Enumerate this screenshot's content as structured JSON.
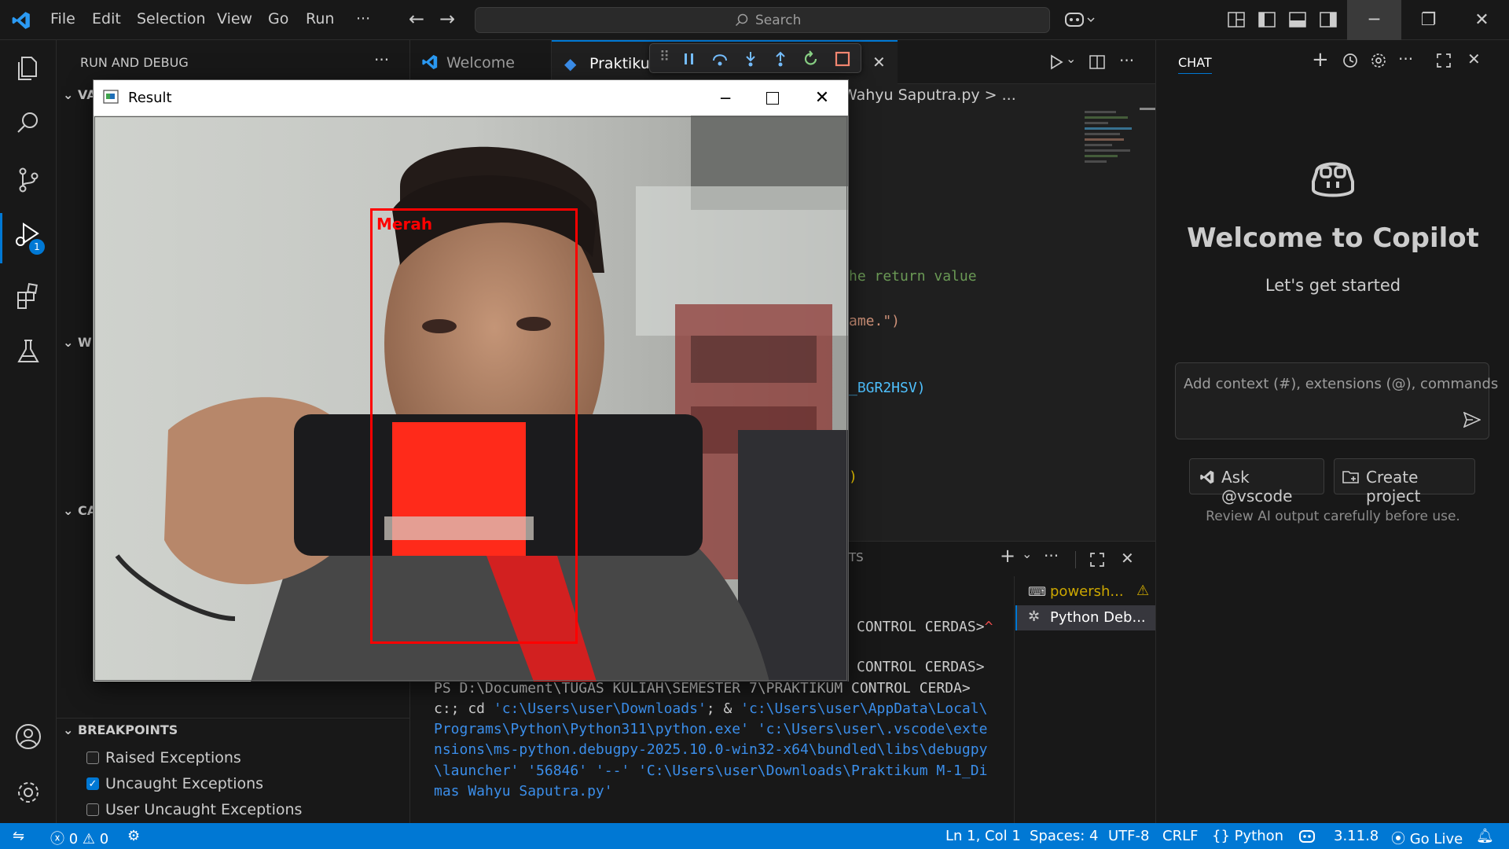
{
  "titlebar": {
    "menus": [
      "File",
      "Edit",
      "Selection",
      "View",
      "Go",
      "Run",
      "···"
    ],
    "search_placeholder": "Search"
  },
  "activitybar": {
    "debug_badge": "1"
  },
  "sidebar": {
    "title": "RUN AND DEBUG",
    "more": "···",
    "sections": [
      "VA",
      "W",
      "CA"
    ],
    "breakpoints_title": "BREAKPOINTS",
    "breakpoints": [
      {
        "label": "Raised Exceptions",
        "checked": false
      },
      {
        "label": "Uncaught Exceptions",
        "checked": true
      },
      {
        "label": "User Uncaught Exceptions",
        "checked": false
      }
    ]
  },
  "tabs": [
    {
      "label": "Welcome"
    },
    {
      "label": "Praktikum"
    }
  ],
  "breadcrumb": "Wahyu Saputra.py > ...",
  "code_lines": [
    {
      "text": "he return value",
      "color": "#6a9955"
    },
    {
      "text": "ame.\")",
      "color": "#ce9178"
    },
    {
      "text": "_BGR2HSV)",
      "color": "#4fc1ff"
    },
    {
      "text": ")",
      "color": "#ffd700"
    }
  ],
  "panel": {
    "tab_fragment": "TS",
    "terminals": [
      {
        "label": "powersh...",
        "warning": true
      },
      {
        "label": "Python Deb...",
        "active": true
      }
    ],
    "lines": [
      {
        "segments": [
          {
            "t": "CONTROL CERDAS>",
            "c": ""
          },
          {
            "t": "^",
            "c": "red"
          }
        ]
      },
      {
        "segments": [
          {
            "t": "CONTROL CERDAS>",
            "c": ""
          }
        ]
      },
      {
        "segments": [
          {
            "t": "PS D:\\Document\\TUGAS KULIAH\\SEMESTER 7\\PRAKTIKUM CONTROL CERDA>",
            "c": ""
          }
        ]
      },
      {
        "segments": [
          {
            "t": "c:; cd ",
            "c": ""
          },
          {
            "t": "'c:\\Users\\user\\Downloads'",
            "c": "cy"
          },
          {
            "t": "; & ",
            "c": ""
          },
          {
            "t": "'c:\\Users\\user\\AppData\\Local\\",
            "c": "cy"
          }
        ]
      },
      {
        "segments": [
          {
            "t": "Programs\\Python\\Python311\\python.exe' 'c:\\Users\\user\\.vscode\\exte",
            "c": "cy"
          }
        ]
      },
      {
        "segments": [
          {
            "t": "nsions\\ms-python.debugpy-2025.10.0-win32-x64\\bundled\\libs\\debugpy",
            "c": "cy"
          }
        ]
      },
      {
        "segments": [
          {
            "t": "\\launcher' '56846' '--' 'C:\\Users\\user\\Downloads\\Praktikum M-1_Di",
            "c": "cy"
          }
        ]
      },
      {
        "segments": [
          {
            "t": "mas Wahyu Saputra.py'",
            "c": "cy"
          }
        ]
      }
    ]
  },
  "chat": {
    "header": "CHAT",
    "welcome_title": "Welcome to Copilot",
    "welcome_sub": "Let's get started",
    "input_placeholder": "Add context (#), extensions (@), commands",
    "ask_button": "Ask @vscode",
    "create_button": "Create project",
    "disclaimer": "Review AI output carefully before use."
  },
  "result_window": {
    "title": "Result",
    "detection_label": "Merah",
    "detection_color": "#ff0000"
  },
  "statusbar": {
    "errors": "0",
    "warnings": "0",
    "position": "Ln 1, Col 1",
    "spaces": "Spaces: 4",
    "encoding": "UTF-8",
    "eol": "CRLF",
    "language": "Python",
    "python_version": "3.11.8",
    "go_live": "Go Live"
  },
  "colors": {
    "accent": "#0078d4",
    "background": "#1f1f1f"
  }
}
